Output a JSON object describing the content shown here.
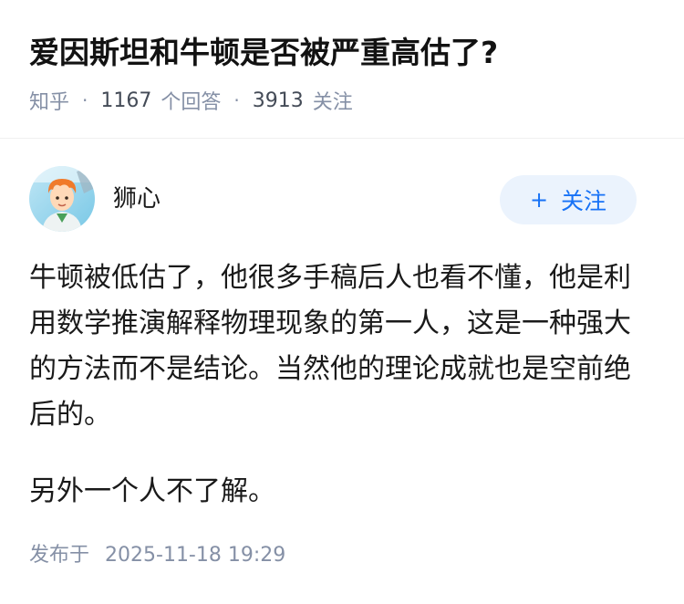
{
  "question": {
    "title": "爱因斯坦和牛顿是否被严重高估了?",
    "source": "知乎",
    "answers_count": "1167",
    "answers_label": "个回答",
    "followers_count": "3913",
    "followers_label": "关注",
    "separator": "·"
  },
  "answer": {
    "author_name": "狮心",
    "avatar_icon": "avatar-image",
    "follow_button": {
      "icon": "plus-icon",
      "symbol": "+",
      "label": "关注",
      "bg_color": "#ebf3fd",
      "text_color": "#1772f6"
    },
    "paragraphs": [
      "牛顿被低估了，他很多手稿后人也看不懂，他是利用数学推演解释物理现象的第一人，这是一种强大的方法而不是结论。当然他的理论成就也是空前绝后的。",
      "另外一个人不了解。"
    ],
    "publish_label": "发布于",
    "publish_time": "2025-11-18 19:29"
  },
  "colors": {
    "meta_gray": "#8590a6",
    "title_text": "#121212"
  }
}
